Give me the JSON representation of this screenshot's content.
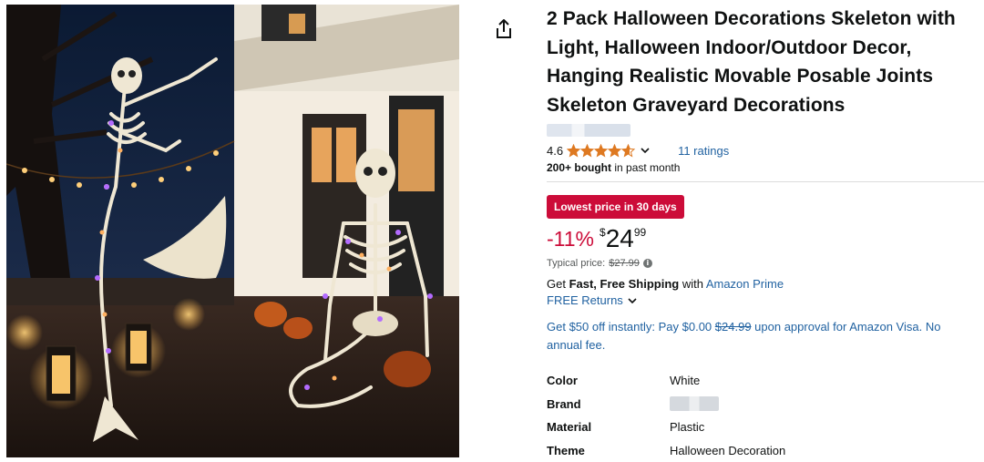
{
  "product": {
    "title": "2 Pack Halloween Decorations Skeleton with Light, Halloween Indoor/Outdoor Decor, Hanging Realistic Movable Posable Joints Skeleton Graveyard Decorations",
    "rating_value": "4.6",
    "rating_stars": 4.6,
    "ratings_count": "11 ratings",
    "bought_bold": "200+ bought",
    "bought_rest": " in past month",
    "deal_badge": "Lowest price in 30 days",
    "discount": "-11%",
    "price_symbol": "$",
    "price_whole": "24",
    "price_fraction": "99",
    "typical_label": "Typical price:",
    "typical_price": "$27.99",
    "shipping_prefix": "Get ",
    "shipping_bold": "Fast, Free Shipping",
    "shipping_mid": " with ",
    "shipping_link": "Amazon Prime",
    "returns_label": "FREE Returns",
    "offer_part1": "Get $50 off instantly: Pay $0.00 ",
    "offer_strike": "$24.99",
    "offer_part2": " upon approval for Amazon Visa. No annual fee."
  },
  "specs": [
    {
      "key": "Color",
      "value": "White"
    },
    {
      "key": "Brand",
      "value": ""
    },
    {
      "key": "Material",
      "value": "Plastic"
    },
    {
      "key": "Theme",
      "value": "Halloween Decoration"
    }
  ],
  "icons": {
    "share": "share-icon",
    "star": "star-icon",
    "chevron": "chevron-down-icon",
    "info": "info-icon"
  },
  "colors": {
    "deal_red": "#cc0c39",
    "link_blue": "#2162a1",
    "star_orange": "#de7921"
  }
}
